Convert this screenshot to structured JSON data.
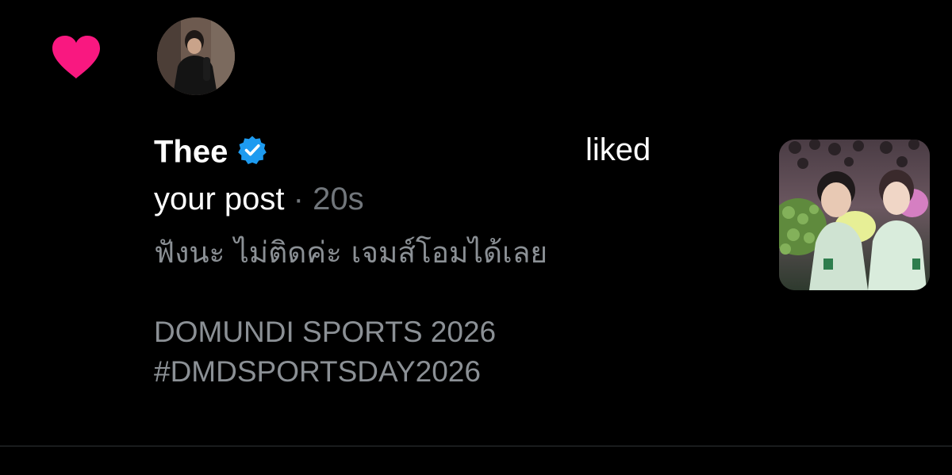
{
  "notification": {
    "type": "like",
    "icon": "heart-icon",
    "accent_color": "#f91880",
    "user": {
      "name": "Thee",
      "verified": true,
      "verified_icon": "verified-badge-icon",
      "verified_color": "#1d9bf0",
      "avatar_icon": "avatar"
    },
    "action_text": "liked",
    "object_text": "your post",
    "separator": " · ",
    "time_ago": "20s",
    "preview": {
      "line1": "ฟังนะ ไม่ติดค่ะ เจมส์โอมได้เลย",
      "line2": "DOMUNDI SPORTS 2026",
      "line3": "#DMDSPORTSDAY2026"
    },
    "thumbnail_icon": "post-thumbnail"
  }
}
